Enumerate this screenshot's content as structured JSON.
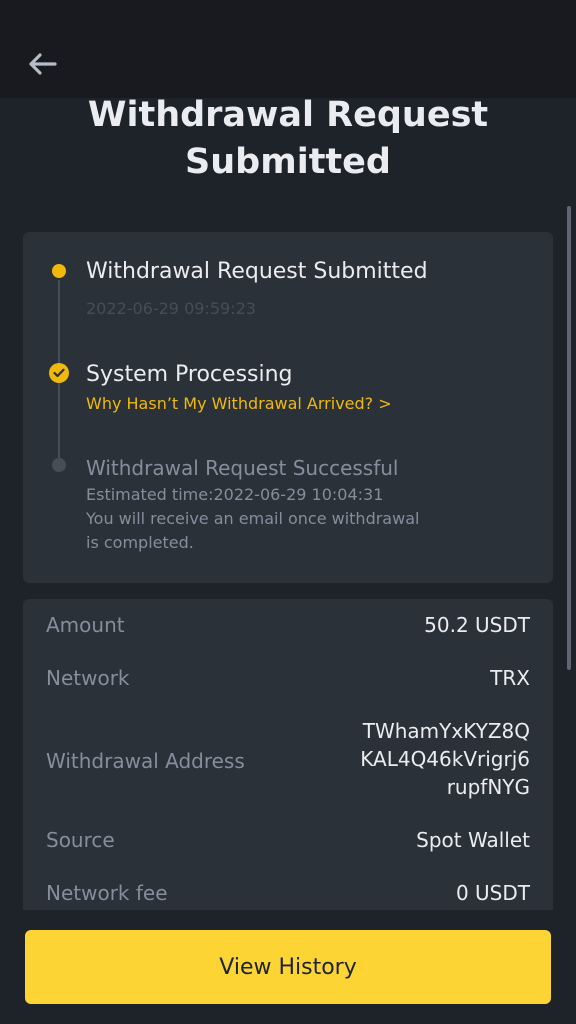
{
  "header": {
    "back_icon": "arrow-left-icon",
    "title": "Withdrawal Request Submitted"
  },
  "timeline": {
    "steps": [
      {
        "title": "Withdrawal Request Submitted",
        "time": "2022-06-29 09:59:23",
        "status": "done"
      },
      {
        "title": "System Processing",
        "link": "Why Hasn’t My Withdrawal Arrived? >",
        "status": "current"
      },
      {
        "title": "Withdrawal Request Successful",
        "estimate": "Estimated time:2022-06-29 10:04:31",
        "note": "You will receive an email once withdrawal is completed.",
        "status": "pending"
      }
    ]
  },
  "details": {
    "amount": {
      "label": "Amount",
      "value": "50.2 USDT"
    },
    "network": {
      "label": "Network",
      "value": "TRX"
    },
    "address": {
      "label": "Withdrawal Address",
      "value": "TWhamYxKYZ8QKAL4Q46kVrigrj6rupfNYG"
    },
    "source": {
      "label": "Source",
      "value": "Spot Wallet"
    },
    "fee": {
      "label": "Network fee",
      "value": "0 USDT"
    }
  },
  "footer": {
    "button_label": "View History"
  },
  "colors": {
    "accent": "#f0b90b",
    "button": "#fcd535",
    "background": "#1e2329",
    "card": "#2b3139"
  }
}
